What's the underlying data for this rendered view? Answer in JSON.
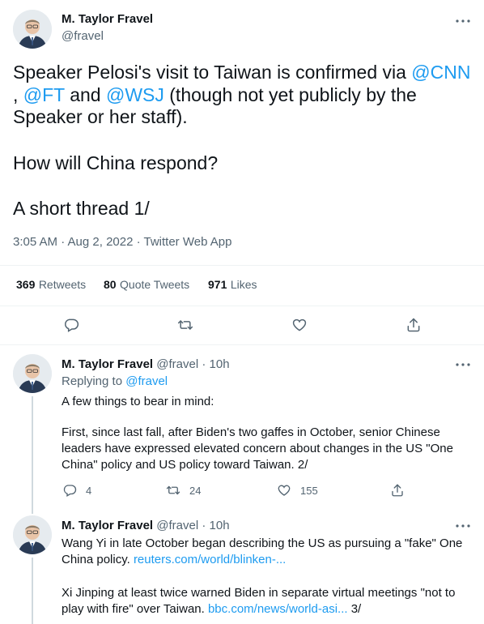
{
  "main_tweet": {
    "author_name": "M. Taylor Fravel",
    "author_handle": "@fravel",
    "text_part1": "Speaker Pelosi's visit to Taiwan is confirmed via ",
    "mention_cnn": "@CNN",
    "text_part2": ", ",
    "mention_ft": "@FT",
    "text_part3": " and ",
    "mention_wsj": "@WSJ",
    "text_part4": " (though not yet publicly by the Speaker or her staff).",
    "paragraph2": "How will China respond?",
    "paragraph3": "A short thread 1/",
    "timestamp": "3:05 AM · Aug 2, 2022 · Twitter Web App",
    "retweets_count": "369",
    "retweets_label": "Retweets",
    "quotes_count": "80",
    "quotes_label": "Quote Tweets",
    "likes_count": "971",
    "likes_label": "Likes"
  },
  "replies": [
    {
      "author_name": "M. Taylor Fravel",
      "author_handle": "@fravel",
      "time": "· 10h",
      "replying_prefix": "Replying to ",
      "replying_handle": "@fravel",
      "paragraph1": "A few things to bear in mind:",
      "paragraph2": "First, since last fall, after Biden's two gaffes in October, senior Chinese leaders have expressed elevated concern about changes in the US \"One China\" policy and US policy toward Taiwan.  2/",
      "reply_count": "4",
      "retweet_count": "24",
      "like_count": "155"
    },
    {
      "author_name": "M. Taylor Fravel",
      "author_handle": "@fravel",
      "time": "· 10h",
      "paragraph1_text": "Wang Yi in late October began describing the US as pursuing a \"fake\" One China policy. ",
      "paragraph1_link": "reuters.com/world/blinken-...",
      "paragraph2_text": "Xi Jinping at least twice warned Biden in separate virtual meetings \"not to play with fire\" over Taiwan. ",
      "paragraph2_link": "bbc.com/news/world-asi...",
      "paragraph2_suffix": " 3/"
    }
  ],
  "icons": {
    "more": "more-icon",
    "reply": "reply-icon",
    "retweet": "retweet-icon",
    "like": "like-icon",
    "share": "share-icon"
  },
  "colors": {
    "link": "#1d9bf0",
    "muted": "#536471",
    "text": "#0f1419"
  }
}
